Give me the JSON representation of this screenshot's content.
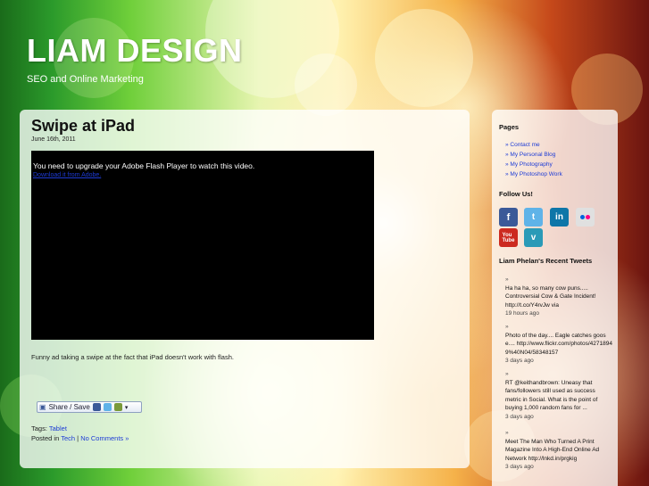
{
  "site": {
    "title": "LIAM DESIGN",
    "tagline": "SEO and Online Marketing"
  },
  "post": {
    "title": "Swipe at iPad",
    "date": "June 16th, 2011",
    "video_message": "You need to upgrade your Adobe Flash Player to watch this video.",
    "video_link": "Download it from Adobe.",
    "caption": "Funny ad taking a swipe at the fact that iPad doesn't work with flash.",
    "share_label": "Share / Save",
    "tags_label": "Tags:",
    "tag": "Tablet",
    "posted_in_label": "Posted in",
    "category": "Tech",
    "separator": "|",
    "comments": "No Comments »"
  },
  "sidebar": {
    "pages_title": "Pages",
    "pages": [
      {
        "label": "» Contact me"
      },
      {
        "label": "» My Personal Blog"
      },
      {
        "label": "» My Photography"
      },
      {
        "label": "» My Photoshop Work"
      }
    ],
    "follow_title": "Follow Us!",
    "social_icons": [
      "facebook-icon",
      "twitter-icon",
      "linkedin-icon",
      "flickr-icon",
      "youtube-icon",
      "vimeo-icon"
    ],
    "tweets_title": "Liam Phelan's Recent Tweets",
    "tweets": [
      {
        "bullet": "»",
        "text": "Ha ha ha, so many cow puns..... Controversial Cow & Gate Incident! http://t.co/Y4rvJw via",
        "when": "19 hours ago"
      },
      {
        "bullet": "»",
        "text": "Photo of the day.... Eagle catches goose.... http://www.flickr.com/photos/42718949%40N04/58348157",
        "when": "3 days ago"
      },
      {
        "bullet": "»",
        "text": "RT @keithandbrown: Uneasy that fans/followers still used as success metric in Social. What is the point of buying 1,000 random fans for ...",
        "when": "3 days ago"
      },
      {
        "bullet": "»",
        "text": "Meet The Man Who Turned A Print Magazine Into A High-End Online Ad Network http://lnkd.in/prgkig",
        "when": "3 days ago"
      }
    ]
  },
  "colors": {
    "link": "#1d3bd6",
    "facebook": "#3b5998",
    "twitter": "#5fb3e8",
    "linkedin": "#0e76a8",
    "flickr": "#e0e0e0",
    "youtube": "#cc2a1f",
    "vimeo": "#2a9ab7"
  }
}
